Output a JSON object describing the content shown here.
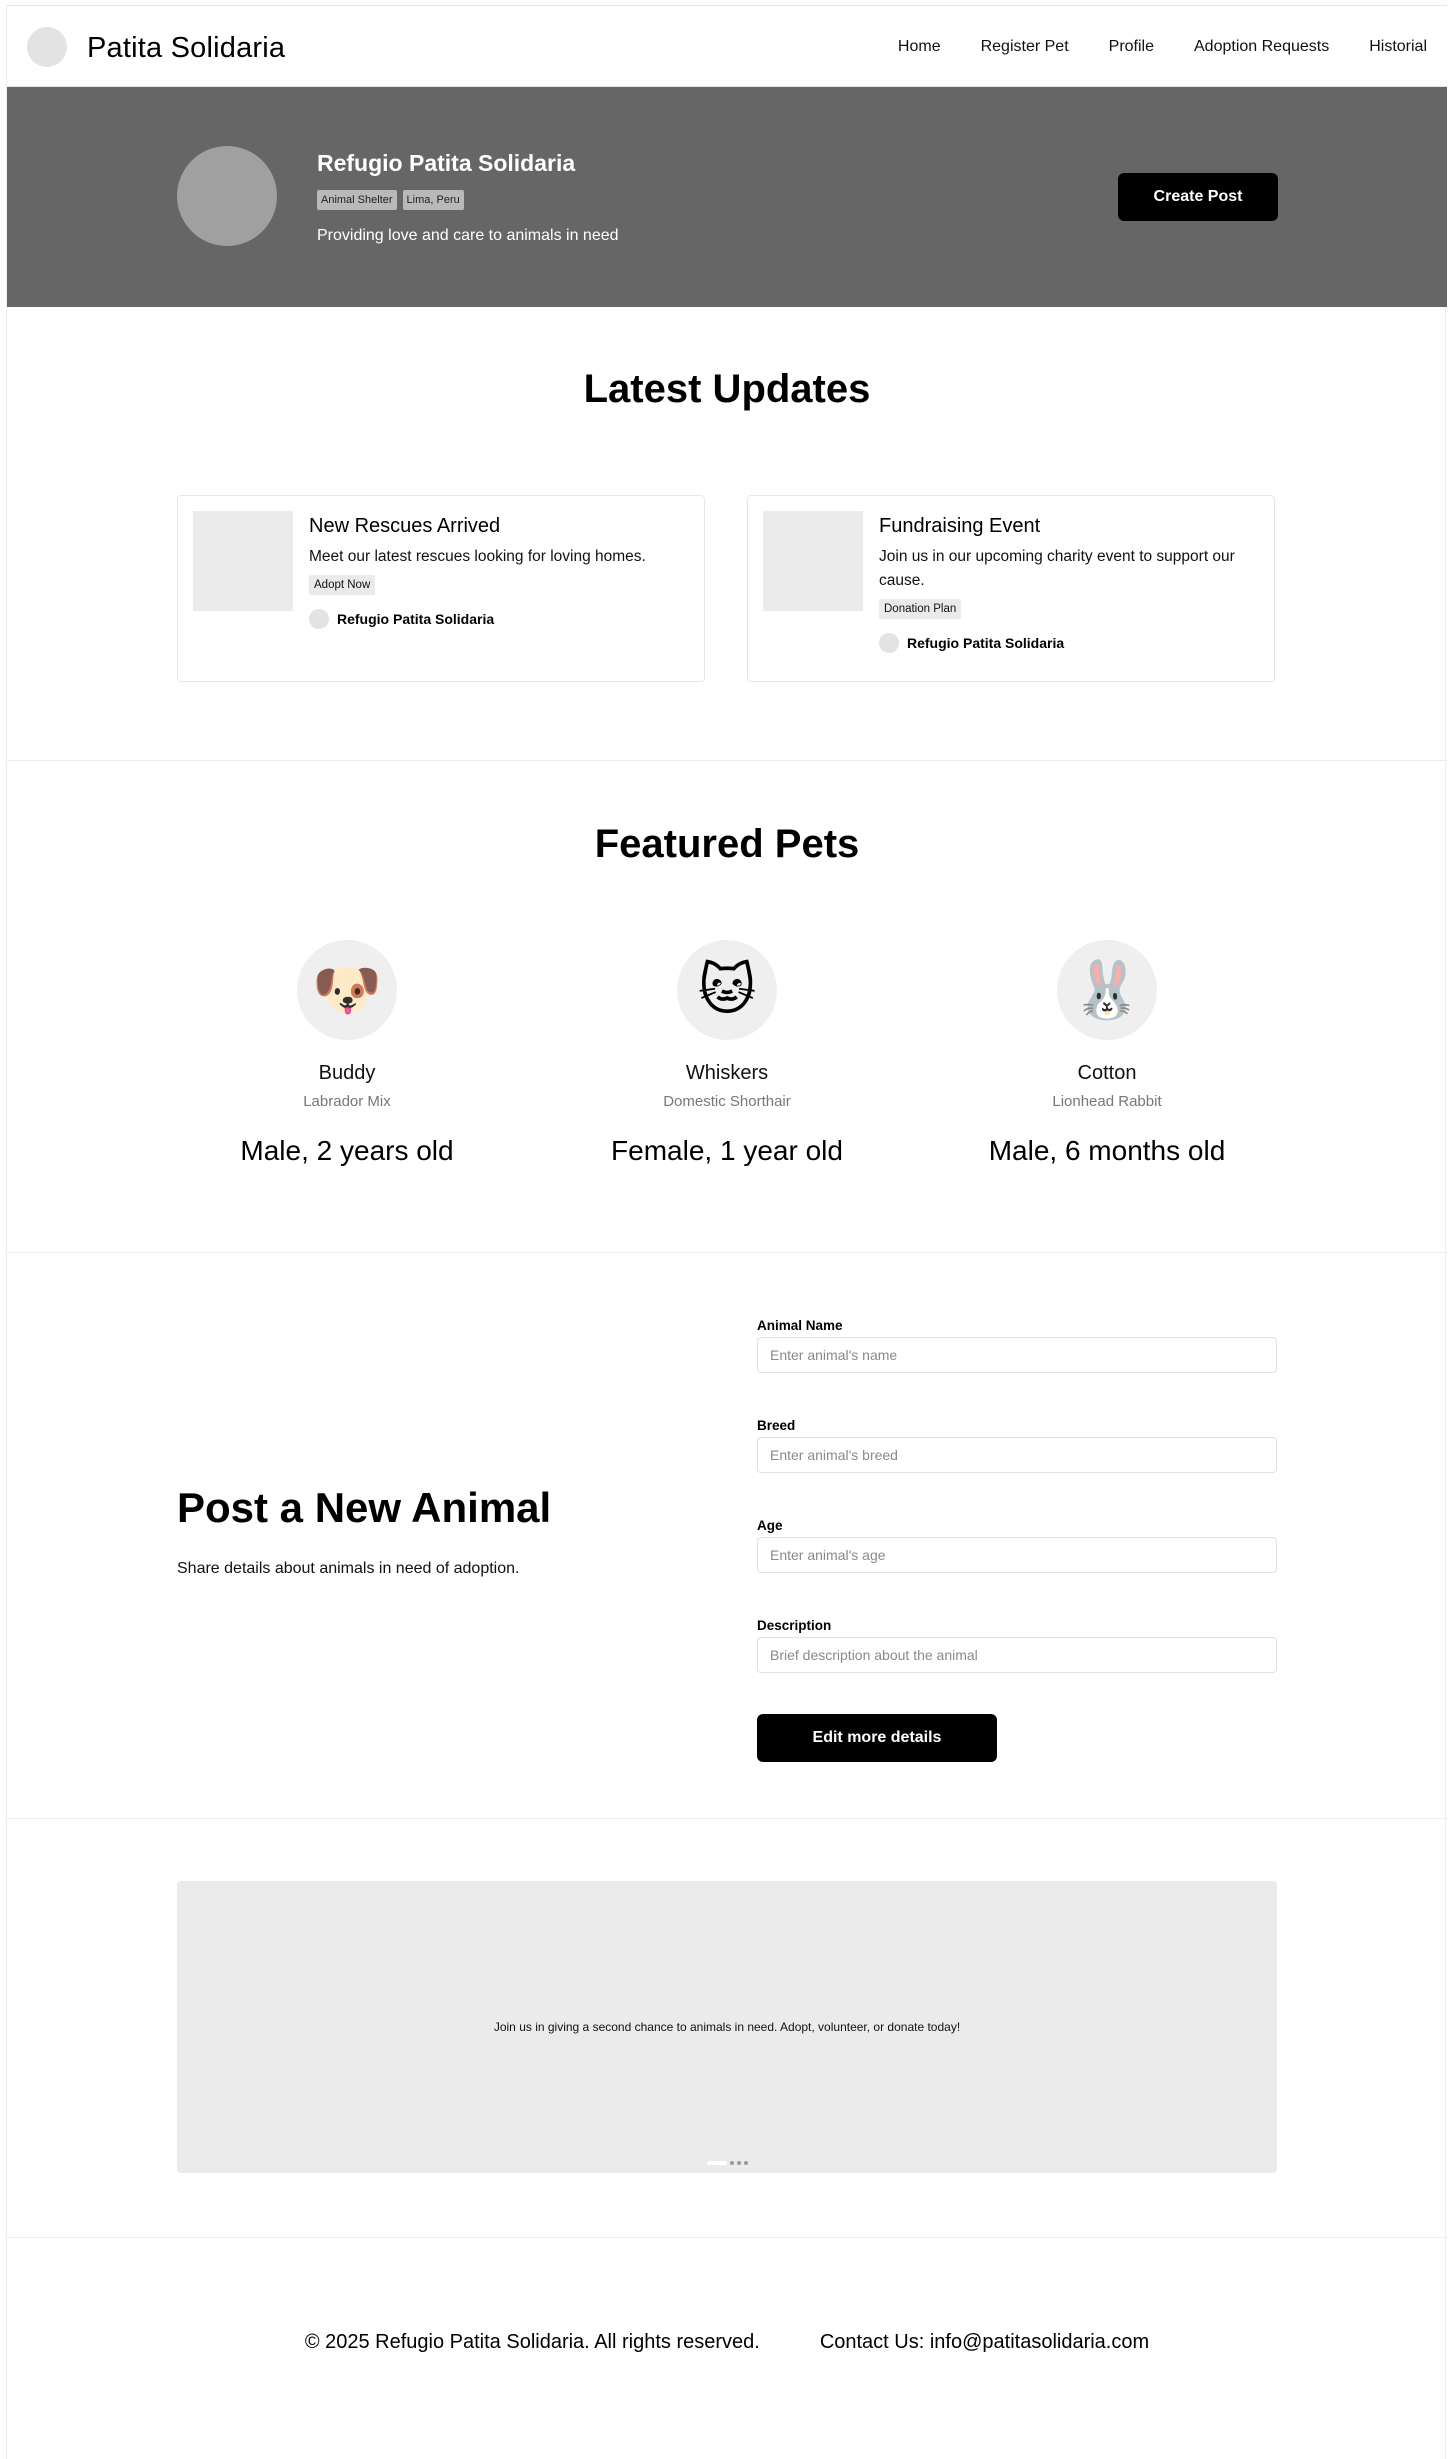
{
  "nav": {
    "brand": "Patita Solidaria",
    "links": [
      "Home",
      "Register Pet",
      "Profile",
      "Adoption Requests",
      "Historial"
    ]
  },
  "hero": {
    "name": "Refugio Patita Solidaria",
    "tags": [
      "Animal Shelter",
      "Lima, Peru"
    ],
    "description": "Providing love and care to animals in need",
    "button": "Create Post"
  },
  "updates": {
    "title": "Latest Updates",
    "cards": [
      {
        "title": "New Rescues Arrived",
        "text": "Meet our latest rescues looking for loving homes.",
        "tag": "Adopt Now",
        "author": "Refugio Patita Solidaria"
      },
      {
        "title": "Fundraising Event",
        "text": "Join us in our upcoming charity event to support our cause.",
        "tag": "Donation Plan",
        "author": "Refugio Patita Solidaria"
      }
    ]
  },
  "pets": {
    "title": "Featured Pets",
    "items": [
      {
        "icon": "🐶",
        "name": "Buddy",
        "breed": "Labrador Mix",
        "meta": "Male, 2 years old"
      },
      {
        "icon": "🐱",
        "name": "Whiskers",
        "breed": "Domestic Shorthair",
        "meta": "Female, 1 year old"
      },
      {
        "icon": "🐰",
        "name": "Cotton",
        "breed": "Lionhead Rabbit",
        "meta": "Male, 6 months old"
      }
    ]
  },
  "post_form": {
    "title": "Post a New Animal",
    "subtitle": "Share details about animals in need of adoption.",
    "fields": [
      {
        "label": "Animal Name",
        "placeholder": "Enter animal's name"
      },
      {
        "label": "Breed",
        "placeholder": "Enter animal's breed"
      },
      {
        "label": "Age",
        "placeholder": "Enter animal's age"
      },
      {
        "label": "Description",
        "placeholder": "Brief description about the animal"
      }
    ],
    "button": "Edit more details"
  },
  "banner": {
    "text": "Join us in giving a second chance to animals in need. Adopt, volunteer, or donate today!",
    "slides": 4,
    "active_slide": 1
  },
  "footer": {
    "copyright": "© 2025 Refugio Patita Solidaria. All rights reserved.",
    "contact": "Contact Us: info@patitasolidaria.com"
  }
}
